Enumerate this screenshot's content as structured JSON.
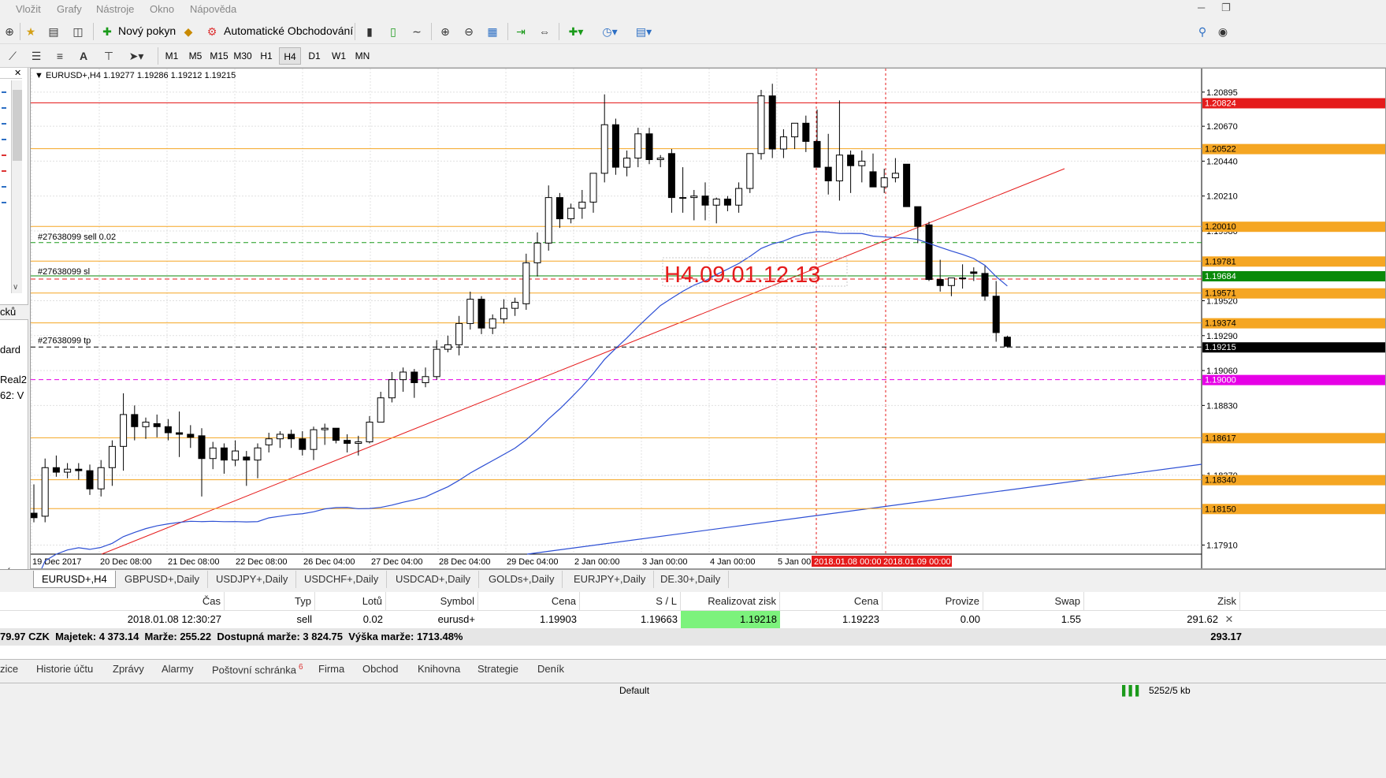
{
  "menu": [
    "Vložit",
    "Grafy",
    "Nástroje",
    "Okno",
    "Nápověda"
  ],
  "toolbar1": {
    "new_order": "Nový pokyn",
    "auto_trading": "Automatické Obchodování"
  },
  "timeframes": [
    "M1",
    "M5",
    "M15",
    "M30",
    "H1",
    "H4",
    "D1",
    "W1",
    "MN"
  ],
  "active_timeframe": "H4",
  "left_panel": [
    "cků",
    "dard",
    "Real2",
    "62: V",
    "né"
  ],
  "chart": {
    "header": "EURUSD+,H4  1.19277 1.19286 1.19212 1.19215",
    "annotation": "H4.09.01.12.13",
    "order_labels": {
      "sell": "#27638099 sell 0.02",
      "sl": "#27638099 sl",
      "tp": "#27638099 tp"
    },
    "x_labels": [
      "19 Dec 2017",
      "20 Dec 08:00",
      "21 Dec 08:00",
      "22 Dec 08:00",
      "26 Dec 04:00",
      "27 Dec 04:00",
      "28 Dec 04:00",
      "29 Dec 04:00",
      "2 Jan 00:00",
      "3 Jan 00:00",
      "4 Jan 00:00",
      "5 Jan 00:00"
    ],
    "x_label_marked": [
      "2018.01.08 00:00",
      "2018.01.09 00:00"
    ],
    "price_ticks": [
      "1.20895",
      "1.20670",
      "1.20440",
      "1.20210",
      "1.19980",
      "1.19520",
      "1.19290",
      "1.19060",
      "1.18830",
      "1.18370",
      "1.17910"
    ],
    "price_levels": [
      {
        "label": "1.20824",
        "color": "#e51b1b"
      },
      {
        "label": "1.20522",
        "color": "#f5a623"
      },
      {
        "label": "1.20010",
        "color": "#f5a623"
      },
      {
        "label": "1.19781",
        "color": "#f5a623"
      },
      {
        "label": "1.19684",
        "color": "#0a8a0a"
      },
      {
        "label": "1.19571",
        "color": "#f5a623"
      },
      {
        "label": "1.19374",
        "color": "#f5a623"
      },
      {
        "label": "1.19215",
        "color": "#000000"
      },
      {
        "label": "1.19000",
        "color": "#e600e6"
      },
      {
        "label": "1.18617",
        "color": "#f5a623"
      },
      {
        "label": "1.18340",
        "color": "#f5a623"
      },
      {
        "label": "1.18150",
        "color": "#f5a623"
      }
    ]
  },
  "chart_data": {
    "type": "candlestick",
    "symbol": "EURUSD+",
    "timeframe": "H4",
    "ohlc_last": {
      "open": 1.19277,
      "high": 1.19286,
      "low": 1.19212,
      "close": 1.19215
    },
    "ylim": [
      1.1785,
      1.2105
    ],
    "candles": [
      [
        1.1812,
        1.1831,
        1.1806,
        1.1809
      ],
      [
        1.181,
        1.1848,
        1.1806,
        1.1842
      ],
      [
        1.1842,
        1.185,
        1.1836,
        1.1839
      ],
      [
        1.1839,
        1.1845,
        1.1835,
        1.1841
      ],
      [
        1.1841,
        1.1845,
        1.1834,
        1.184
      ],
      [
        1.184,
        1.1844,
        1.1824,
        1.1828
      ],
      [
        1.1828,
        1.1847,
        1.1823,
        1.1842
      ],
      [
        1.1842,
        1.186,
        1.183,
        1.1856
      ],
      [
        1.1856,
        1.1891,
        1.184,
        1.1877
      ],
      [
        1.1877,
        1.1883,
        1.186,
        1.1869
      ],
      [
        1.1869,
        1.1875,
        1.1861,
        1.1872
      ],
      [
        1.1871,
        1.1877,
        1.1862,
        1.1869
      ],
      [
        1.1869,
        1.1874,
        1.186,
        1.1865
      ],
      [
        1.1865,
        1.1879,
        1.1849,
        1.1864
      ],
      [
        1.1864,
        1.187,
        1.1855,
        1.1862
      ],
      [
        1.1863,
        1.1868,
        1.1823,
        1.1848
      ],
      [
        1.1848,
        1.1859,
        1.1841,
        1.1855
      ],
      [
        1.1855,
        1.1858,
        1.1838,
        1.1847
      ],
      [
        1.1847,
        1.186,
        1.1843,
        1.1853
      ],
      [
        1.1849,
        1.1853,
        1.183,
        1.1847
      ],
      [
        1.1847,
        1.1858,
        1.1835,
        1.1855
      ],
      [
        1.1857,
        1.1865,
        1.1852,
        1.1861
      ],
      [
        1.1861,
        1.1866,
        1.1855,
        1.1864
      ],
      [
        1.1864,
        1.1867,
        1.1855,
        1.1861
      ],
      [
        1.1861,
        1.1866,
        1.185,
        1.1854
      ],
      [
        1.1854,
        1.1869,
        1.1847,
        1.1867
      ],
      [
        1.1867,
        1.1871,
        1.1857,
        1.1868
      ],
      [
        1.1868,
        1.1868,
        1.1858,
        1.186
      ],
      [
        1.186,
        1.1864,
        1.1852,
        1.1858
      ],
      [
        1.1858,
        1.1863,
        1.185,
        1.1859
      ],
      [
        1.1859,
        1.1876,
        1.1858,
        1.1872
      ],
      [
        1.1872,
        1.1892,
        1.1872,
        1.1888
      ],
      [
        1.1888,
        1.1905,
        1.1885,
        1.19
      ],
      [
        1.19,
        1.1908,
        1.1892,
        1.1905
      ],
      [
        1.1905,
        1.1907,
        1.1888,
        1.1898
      ],
      [
        1.1898,
        1.1908,
        1.1895,
        1.1902
      ],
      [
        1.1902,
        1.1926,
        1.19,
        1.192
      ],
      [
        1.192,
        1.1929,
        1.1918,
        1.1923
      ],
      [
        1.1923,
        1.1942,
        1.1916,
        1.1937
      ],
      [
        1.1937,
        1.1958,
        1.1933,
        1.1953
      ],
      [
        1.1953,
        1.1955,
        1.193,
        1.1934
      ],
      [
        1.1934,
        1.1943,
        1.193,
        1.194
      ],
      [
        1.194,
        1.1953,
        1.1937,
        1.1947
      ],
      [
        1.1947,
        1.1954,
        1.1942,
        1.1951
      ],
      [
        1.195,
        1.1983,
        1.1946,
        1.1977
      ],
      [
        1.1977,
        1.1997,
        1.1968,
        1.199
      ],
      [
        1.199,
        1.2028,
        1.1985,
        1.202
      ],
      [
        1.202,
        1.2023,
        1.2,
        1.2006
      ],
      [
        1.2006,
        1.2016,
        1.2003,
        1.2013
      ],
      [
        1.2013,
        1.2025,
        1.2006,
        1.2017
      ],
      [
        1.2017,
        1.2035,
        1.201,
        1.2036
      ],
      [
        1.2036,
        1.2088,
        1.203,
        1.2068
      ],
      [
        1.2068,
        1.2072,
        1.2035,
        1.204
      ],
      [
        1.204,
        1.2051,
        1.2034,
        1.2046
      ],
      [
        1.2046,
        1.2066,
        1.204,
        1.2062
      ],
      [
        1.2062,
        1.2066,
        1.2042,
        1.2045
      ],
      [
        1.2045,
        1.2048,
        1.204,
        1.2046
      ],
      [
        1.2049,
        1.2052,
        1.201,
        1.202
      ],
      [
        1.202,
        1.204,
        1.201,
        1.202
      ],
      [
        1.202,
        1.2025,
        1.2005,
        1.2021
      ],
      [
        1.2021,
        1.203,
        1.2005,
        1.2015
      ],
      [
        1.2015,
        1.202,
        1.2003,
        1.2019
      ],
      [
        1.2019,
        1.2021,
        1.2011,
        1.2015
      ],
      [
        1.2015,
        1.203,
        1.201,
        1.2026
      ],
      [
        1.2026,
        1.2049,
        1.2023,
        1.2049
      ],
      [
        1.2049,
        1.2091,
        1.2045,
        1.2087
      ],
      [
        1.2087,
        1.2095,
        1.2046,
        1.2052
      ],
      [
        1.2052,
        1.2065,
        1.2046,
        1.206
      ],
      [
        1.206,
        1.2065,
        1.2052,
        1.2069
      ],
      [
        1.2069,
        1.2074,
        1.205,
        1.2057
      ],
      [
        1.2057,
        1.2078,
        1.204,
        1.204
      ],
      [
        1.204,
        1.2062,
        1.2022,
        1.2031
      ],
      [
        1.2031,
        1.2084,
        1.2018,
        1.2048
      ],
      [
        1.2048,
        1.2051,
        1.2023,
        1.2041
      ],
      [
        1.2041,
        1.2051,
        1.203,
        1.2044
      ],
      [
        1.2037,
        1.2049,
        1.2028,
        1.2027
      ],
      [
        1.2027,
        1.2039,
        1.2023,
        1.2033
      ],
      [
        1.2033,
        1.2046,
        1.203,
        1.2036
      ],
      [
        1.2042,
        1.2042,
        1.2015,
        1.2014
      ],
      [
        1.2014,
        1.201,
        1.199,
        1.2001
      ],
      [
        1.2002,
        1.2004,
        1.1965,
        1.1966
      ],
      [
        1.1966,
        1.1979,
        1.1958,
        1.1962
      ],
      [
        1.1962,
        1.1966,
        1.1955,
        1.1967
      ],
      [
        1.1967,
        1.1976,
        1.196,
        1.1967
      ],
      [
        1.1971,
        1.1974,
        1.1965,
        1.197
      ],
      [
        1.197,
        1.1975,
        1.1952,
        1.1955
      ],
      [
        1.1955,
        1.1965,
        1.1925,
        1.1931
      ],
      [
        1.1928,
        1.1929,
        1.1921,
        1.1922
      ]
    ],
    "ma_series_name": "",
    "trendline": {
      "from": [
        0,
        1.1785
      ],
      "to": [
        1,
        1.2045
      ]
    }
  },
  "chart_tabs": [
    "EURUSD+,H4",
    "GBPUSD+,Daily",
    "USDJPY+,Daily",
    "USDCHF+,Daily",
    "USDCAD+,Daily",
    "GOLDs+,Daily",
    "EURJPY+,Daily",
    "DE.30+,Daily"
  ],
  "terminal": {
    "columns": [
      "Čas",
      "Typ",
      "Lotů",
      "Symbol",
      "Cena",
      "S / L",
      "Realizovat zisk",
      "Cena",
      "Provize",
      "Swap",
      "Zisk"
    ],
    "row": [
      "2018.01.08 12:30:27",
      "sell",
      "0.02",
      "eurusd+",
      "1.19903",
      "1.19663",
      "1.19218",
      "1.19223",
      "0.00",
      "1.55",
      "291.62"
    ],
    "summary": "79.97 CZK  Majetek: 4 373.14  Marže: 255.22  Dostupná marže: 3 824.75  Výška marže: 1713.48%",
    "summary_total": "293.17"
  },
  "bottom_tabs": [
    "zice",
    "Historie účtu",
    "Zprávy",
    "Alarmy",
    "Poštovní schránka",
    "Firma",
    "Obchod",
    "Knihovna",
    "Strategie",
    "Deník"
  ],
  "mailbox_count": "6",
  "status": {
    "profile": "Default",
    "traffic": "5252/5 kb"
  }
}
